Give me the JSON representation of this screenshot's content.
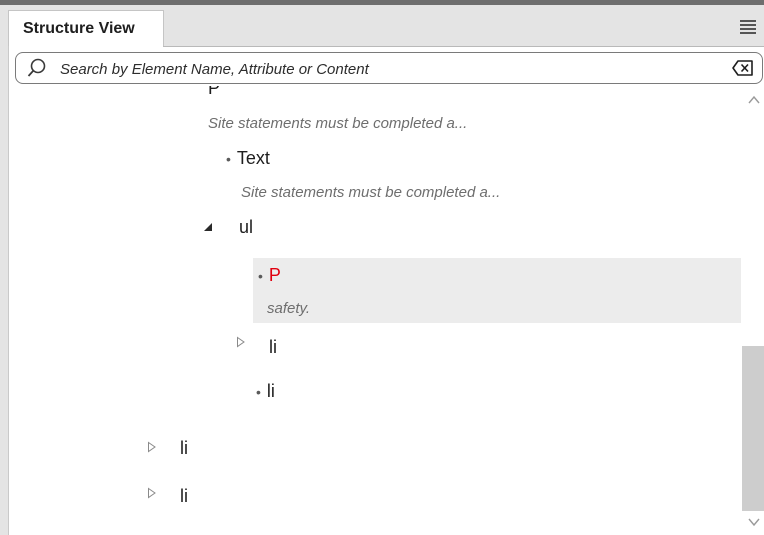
{
  "panel": {
    "tab_label": "Structure View",
    "menu_icon": "hamburger-menu-icon"
  },
  "search": {
    "placeholder": "Search by Element Name, Attribute or Content",
    "value": "",
    "icon": "search-icon",
    "clear_icon": "clear-backspace-icon"
  },
  "tree": {
    "nodes": [
      {
        "tag": "P",
        "content": "Site statements must be completed a..."
      },
      {
        "tag": "Text",
        "content": "Site statements must be completed a..."
      },
      {
        "tag": "ul",
        "expanded": true
      },
      {
        "tag": "P",
        "content": "safety.",
        "selected": true,
        "color": "#e0000f"
      },
      {
        "tag": "li",
        "expanded": false
      },
      {
        "tag": "li"
      },
      {
        "tag": "li",
        "expanded": false
      },
      {
        "tag": "li",
        "expanded": false
      }
    ]
  },
  "colors": {
    "selected_tag": "#e0000f",
    "selected_row_bg": "#ececec",
    "scrollbar_thumb": "#cdcdcd"
  }
}
